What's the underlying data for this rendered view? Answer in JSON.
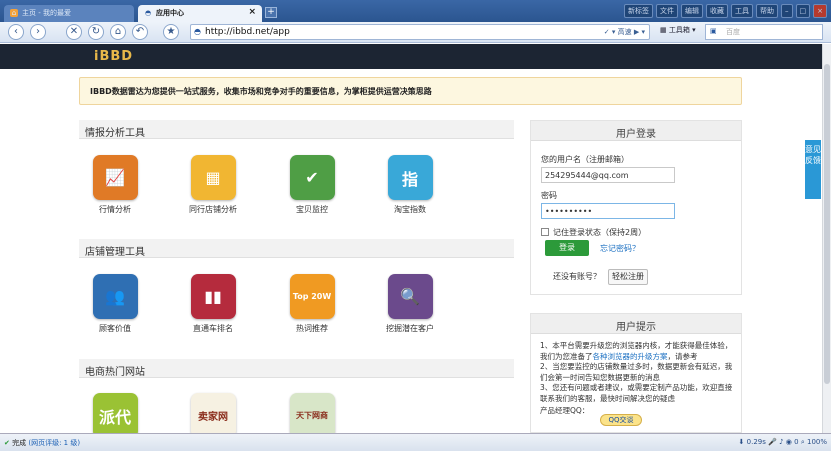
{
  "tabs": [
    {
      "title": "主页 - 我的最爱",
      "active": false
    },
    {
      "title": "应用中心",
      "active": true
    }
  ],
  "top_buttons": [
    "新标签",
    "文件",
    "编辑",
    "收藏",
    "工具",
    "帮助"
  ],
  "address": {
    "url": "http://ibbd.net/app",
    "speed": "高速",
    "tools": "工具箱",
    "search_placeholder": "百度"
  },
  "site": {
    "logo": "iBBD",
    "notice": "IBBD数据雷达为您提供一站式服务，收集市场和竞争对手的重要信息，为掌柜提供运营决策思路"
  },
  "sections": [
    {
      "title": "情报分析工具",
      "tools": [
        {
          "label": "行情分析",
          "icon": "market-chart-icon",
          "color": "#e07a26",
          "glyph": "📈"
        },
        {
          "label": "同行店铺分析",
          "icon": "calculator-icon",
          "color": "#f1b632",
          "glyph": "▦"
        },
        {
          "label": "宝贝监控",
          "icon": "monitor-icon",
          "color": "#4f9e45",
          "glyph": "✔"
        },
        {
          "label": "淘宝指数",
          "icon": "index-icon",
          "color": "#39a8d8",
          "glyph": "指"
        }
      ]
    },
    {
      "title": "店铺管理工具",
      "tools": [
        {
          "label": "顾客价值",
          "icon": "customer-icon",
          "color": "#2f6fb3",
          "glyph": "👥"
        },
        {
          "label": "直通车排名",
          "icon": "ranking-icon",
          "color": "#b52b3d",
          "glyph": "▮▮"
        },
        {
          "label": "热词推荐",
          "icon": "hotword-icon",
          "color": "#f09a22",
          "glyph": "Top 20W"
        },
        {
          "label": "挖掘潜在客户",
          "icon": "search-icon",
          "color": "#6b4a8c",
          "glyph": "🔍"
        }
      ]
    },
    {
      "title": "电商热门网站",
      "tools": [
        {
          "label": "",
          "icon": "paidai-icon",
          "color": "#9ac234",
          "glyph": "派代"
        },
        {
          "label": "",
          "icon": "maijia-icon",
          "color": "#f6f1e2",
          "glyph": "卖家网"
        },
        {
          "label": "",
          "icon": "tianxia-icon",
          "color": "#d8e6c8",
          "glyph": "天下网商"
        }
      ]
    }
  ],
  "login": {
    "title": "用户登录",
    "username_label": "您的用户名（注册邮箱）",
    "username_value": "254295444@qq.com",
    "password_label": "密码",
    "password_value": "••••••••••",
    "remember_label": "记住登录状态（保持2周）",
    "login_button": "登录",
    "forgot": "忘记密码？",
    "no_account": "还没有账号？",
    "register_button": "轻松注册"
  },
  "tips": {
    "title": "用户提示",
    "line1": "1、本平台需要升级您的浏览器内核，才能获得最佳体验，我们为您准备了",
    "line1_link": "各种浏览器的升级方案",
    "line1_end": "，请参考",
    "line2": "2、当您要监控的店铺数量过多时，数据更新会有延迟，我们会第一时间告知您数据更新的消息",
    "line3": "3、您还有问题或者建议，或需要定制产品功能，欢迎直接联系我们的客服，最快时间解决您的疑虑",
    "qq_label": "产品经理QQ：",
    "qq_button": "QQ交谈"
  },
  "feedback": "意见反馈",
  "status": {
    "done": "完成",
    "rating": "(网页评级: 1 级)",
    "time": "0.29s",
    "count": "0",
    "zoom": "100%"
  }
}
